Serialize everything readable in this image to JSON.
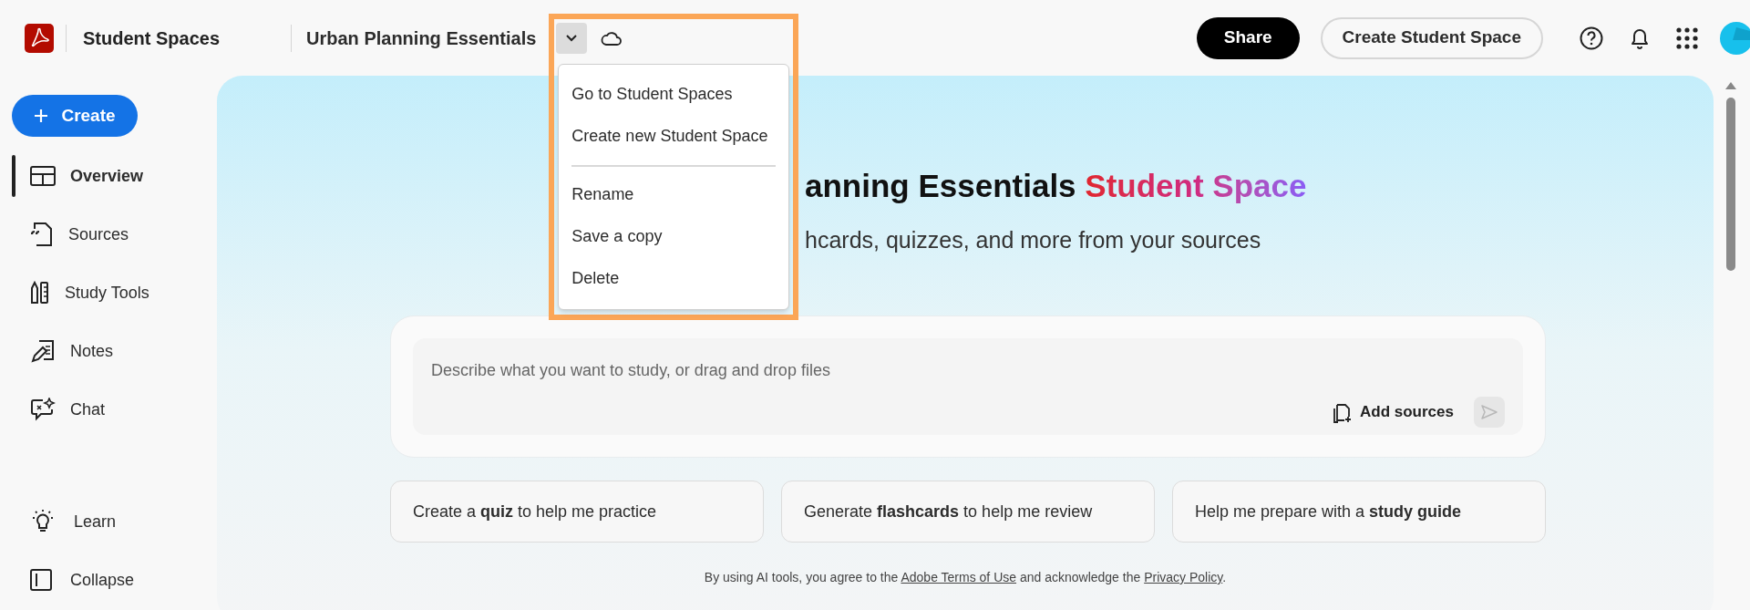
{
  "app": {
    "name": "Student Spaces"
  },
  "space": {
    "title": "Urban Planning Essentials",
    "menu_expanded": true
  },
  "menu": {
    "sections": [
      [
        "Go to Student Spaces",
        "Create new Student Space"
      ],
      [
        "Rename",
        "Save a copy",
        "Delete"
      ]
    ]
  },
  "header_buttons": {
    "share": "Share",
    "create": "Create Student Space"
  },
  "sidebar": {
    "create": "Create",
    "items": [
      {
        "label": "Overview",
        "selected": true
      },
      {
        "label": "Sources",
        "selected": false
      },
      {
        "label": "Study Tools",
        "selected": false
      },
      {
        "label": "Notes",
        "selected": false
      },
      {
        "label": "Chat",
        "selected": false
      }
    ],
    "bottom_items": [
      "Learn",
      "Collapse"
    ]
  },
  "hero": {
    "heading": "anning Essentials",
    "heading_accent": "Student Space",
    "subtitle": "hcards, quizzes, and more from your sources"
  },
  "prompt": {
    "placeholder": "Describe what you want to study, or drag and drop files",
    "add_sources": "Add sources"
  },
  "suggestions": [
    "Create a **quiz** to help me practice",
    "Generate **flashcards** to help me review",
    "Help me prepare with a **study guide**"
  ],
  "footer": [
    {
      "kind": "text",
      "text": "By using AI tools, you agree to the "
    },
    {
      "kind": "link",
      "text": "Adobe Terms of Use"
    },
    {
      "kind": "text",
      "text": " and acknowledge the "
    },
    {
      "kind": "link",
      "text": "Privacy Policy"
    },
    {
      "kind": "text",
      "text": "."
    }
  ]
}
